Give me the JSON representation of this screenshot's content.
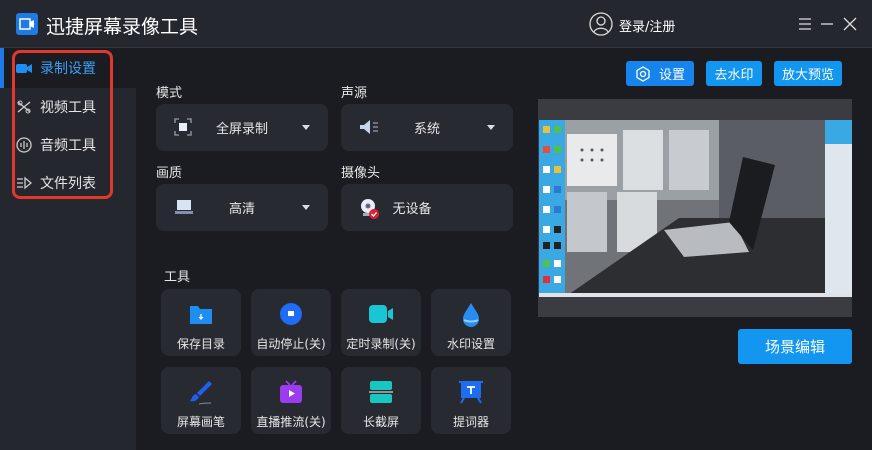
{
  "app": {
    "title": "迅捷屏幕录像工具",
    "login": "登录/注册"
  },
  "sidebar": {
    "items": [
      {
        "label": "录制设置",
        "icon": "video-camera-icon"
      },
      {
        "label": "视频工具",
        "icon": "video-tools-icon"
      },
      {
        "label": "音频工具",
        "icon": "audio-icon"
      },
      {
        "label": "文件列表",
        "icon": "file-list-icon"
      }
    ]
  },
  "settings": {
    "mode": {
      "label": "模式",
      "value": "全屏录制"
    },
    "audio": {
      "label": "声源",
      "value": "系统"
    },
    "quality": {
      "label": "画质",
      "value": "高清"
    },
    "camera": {
      "label": "摄像头",
      "value": "无设备"
    }
  },
  "tools": {
    "label": "工具",
    "items": [
      {
        "label": "保存目录",
        "color": "#1e8ef0"
      },
      {
        "label": "自动停止(关)",
        "color": "#1f6cf5"
      },
      {
        "label": "定时录制(关)",
        "color": "#19c6d6"
      },
      {
        "label": "水印设置",
        "color": "#2a8cf0"
      },
      {
        "label": "屏幕画笔",
        "color": "#2060f0"
      },
      {
        "label": "直播推流(关)",
        "color": "#9b3cf0"
      },
      {
        "label": "长截屏",
        "color": "#19c6c0"
      },
      {
        "label": "提词器",
        "color": "#1e6cf0"
      }
    ]
  },
  "toolbar": {
    "settings": "设置",
    "remove_watermark": "去水印",
    "enlarge_preview": "放大预览"
  },
  "scene_edit": "场景编辑",
  "colors": {
    "accent": "#1296f0",
    "active_text": "#3a9ef5",
    "highlight": "#e0392b"
  }
}
